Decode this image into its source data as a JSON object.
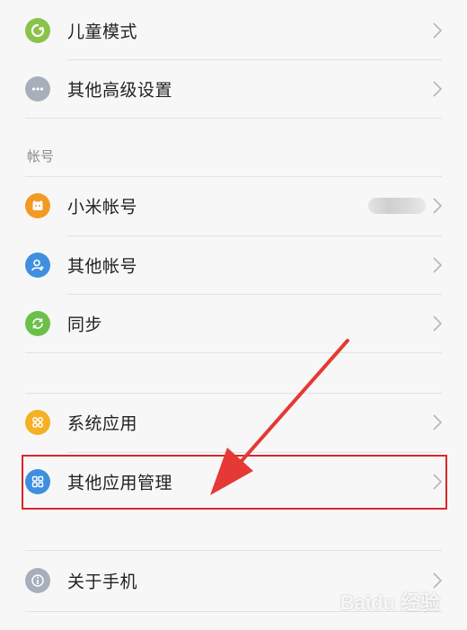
{
  "rows": [
    {
      "label": "儿童模式",
      "icon": "child-mode-icon",
      "color": "#8bc34a"
    },
    {
      "label": "其他高级设置",
      "icon": "more-dots-icon",
      "color": "#a7b0ba"
    }
  ],
  "account_section": {
    "title": "帐号",
    "rows": [
      {
        "label": "小米帐号",
        "icon": "mi-account-icon",
        "color": "#f39a24"
      },
      {
        "label": "其他帐号",
        "icon": "user-add-icon",
        "color": "#3f8fe0"
      },
      {
        "label": "同步",
        "icon": "sync-icon",
        "color": "#6cc04a"
      }
    ]
  },
  "apps_section": {
    "rows": [
      {
        "label": "系统应用",
        "icon": "system-apps-icon",
        "color": "#f5b025"
      },
      {
        "label": "其他应用管理",
        "icon": "apps-grid-icon",
        "color": "#3f8fe0"
      }
    ]
  },
  "about": {
    "label": "关于手机",
    "icon": "info-icon",
    "color": "#a7b0ba"
  },
  "highlight_color": "#d9262c",
  "watermark": "Baidu 经验"
}
